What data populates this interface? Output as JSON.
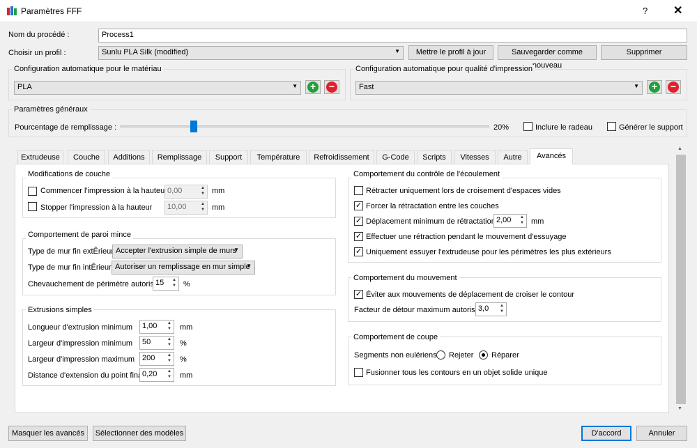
{
  "window": {
    "title": "Paramètres FFF",
    "help": "?",
    "close": "✕"
  },
  "process": {
    "label": "Nom du procédé :",
    "value": "Process1"
  },
  "profile": {
    "label": "Choisir un profil :",
    "value": "Sunlu PLA Silk (modified)",
    "update": "Mettre le profil à jour",
    "save_new": "Sauvegarder comme nouveau",
    "delete": "Supprimer"
  },
  "material": {
    "title": "Configuration automatique pour le matériau",
    "value": "PLA"
  },
  "quality": {
    "title": "Configuration automatique pour qualité d'impression",
    "value": "Fast"
  },
  "general": {
    "title": "Paramètres généraux",
    "infill_label": "Pourcentage de remplissage :",
    "infill_value": "20%",
    "infill_fraction": 0.2,
    "raft": "Inclure le radeau",
    "support": "Générer le support"
  },
  "tabs": [
    "Extrudeuse",
    "Couche",
    "Additions",
    "Remplissage",
    "Support",
    "Température",
    "Refroidissement",
    "G-Code",
    "Scripts",
    "Vitesses",
    "Autre",
    "Avancés"
  ],
  "layer_mods": {
    "title": "Modifications de couche",
    "start_label": "Commencer l'impression à la hauteur",
    "start_value": "0,00",
    "stop_label": "Stopper  l'impression à la hauteur",
    "stop_value": "10,00",
    "unit": "mm"
  },
  "thin_wall": {
    "title": "Comportement de paroi mince",
    "outer_label": "Type de mur fin extÊrieur",
    "outer_value": "Accepter l'extrusion simple de murs",
    "inner_label": "Type de mur fin intÊrieur",
    "inner_value": "Autoriser un remplissage en mur simple",
    "overlap_label": "Chevauchement de périmètre autorisé",
    "overlap_value": "15",
    "overlap_unit": "%"
  },
  "single_ext": {
    "title": "Extrusions simples",
    "rows": [
      {
        "label": "Longueur d'extrusion minimum",
        "value": "1,00",
        "unit": "mm"
      },
      {
        "label": "Largeur d'impression minimum",
        "value": "50",
        "unit": "%"
      },
      {
        "label": "Largeur d'impression maximum",
        "value": "200",
        "unit": "%"
      },
      {
        "label": "Distance d'extension du point final",
        "value": "0,20",
        "unit": "mm"
      }
    ]
  },
  "ooze": {
    "title": "Comportement du contrôle de l'écoulement",
    "r1": "Rétracter uniquement lors de croisement d'espaces vides",
    "r2": "Forcer la rétractation entre les couches",
    "r3": "Déplacement minimum de rétractation",
    "r3_value": "2,00",
    "r3_unit": "mm",
    "r4": "Effectuer une rétraction pendant le mouvement d'essuyage",
    "r5": "Uniquement essuyer l'extrudeuse pour les périmètres les plus extérieurs"
  },
  "movement": {
    "title": "Comportement du mouvement",
    "avoid": "Éviter aux mouvements de déplacement de croiser le contour",
    "detour_label": "Facteur de détour maximum autorisé",
    "detour_value": "3,0"
  },
  "slicing": {
    "title": "Comportement de coupe",
    "segments_label": "Segments non eulériens :",
    "reject": "Rejeter",
    "repair": "Réparer",
    "merge": "Fusionner tous les contours en un objet solide unique"
  },
  "footer": {
    "hide_adv": "Masquer les avancés",
    "select_models": "Sélectionner des modèles",
    "ok": "D'accord",
    "cancel": "Annuler"
  },
  "colors": {
    "add": "#22a13a",
    "remove": "#e0202a",
    "accent": "#0078d7"
  }
}
